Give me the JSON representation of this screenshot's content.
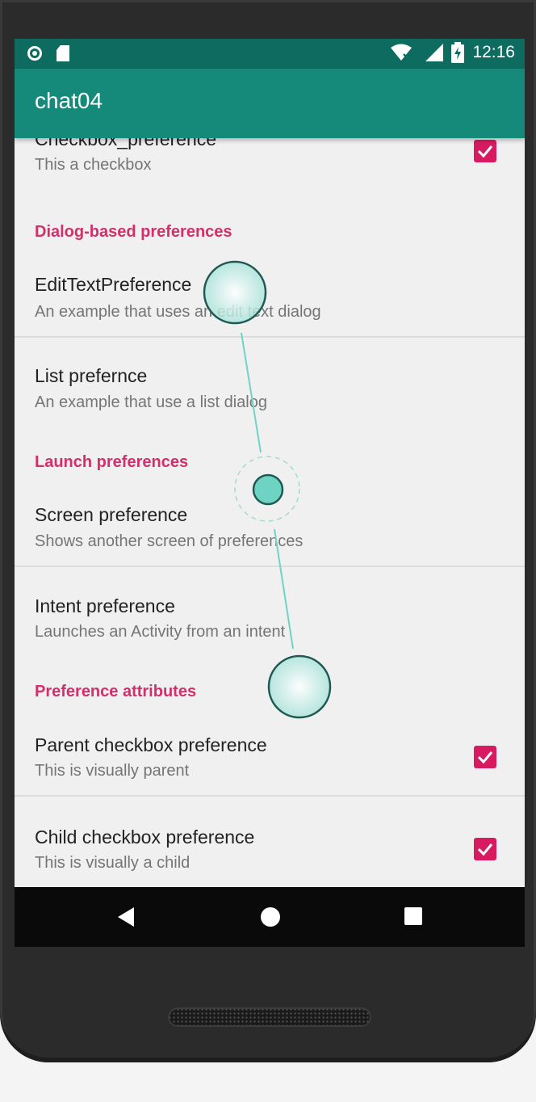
{
  "status_bar": {
    "time": "12:16"
  },
  "app_bar": {
    "title": "chat04"
  },
  "preferences": {
    "checkbox_pref": {
      "title": "Checkbox_preference",
      "summary": "This a checkbox",
      "checked": true
    },
    "dialog_category": "Dialog-based preferences",
    "edit_text": {
      "title": "EditTextPreference",
      "summary": "An example that uses an edit text dialog"
    },
    "list_pref": {
      "title": "List prefernce",
      "summary": "An example that use a list dialog"
    },
    "launch_category": "Launch preferences",
    "screen_pref": {
      "title": "Screen preference",
      "summary": "Shows another screen of preferences"
    },
    "intent_pref": {
      "title": "Intent preference",
      "summary": "Launches an Activity from an intent"
    },
    "attributes_category": "Preference attributes",
    "parent_pref": {
      "title": "Parent checkbox preference",
      "summary": "This is visually parent",
      "checked": true
    },
    "child_pref": {
      "title": "Child checkbox preference",
      "summary": "This is visually a child",
      "checked": true
    }
  },
  "colors": {
    "primary": "#15897a",
    "primary_dark": "#0d6b5f",
    "accent": "#d81b60",
    "touch": "#6fd3c4"
  },
  "icons": {
    "nav_back": "back-triangle-icon",
    "nav_home": "home-circle-icon",
    "nav_recents": "recents-square-icon"
  }
}
